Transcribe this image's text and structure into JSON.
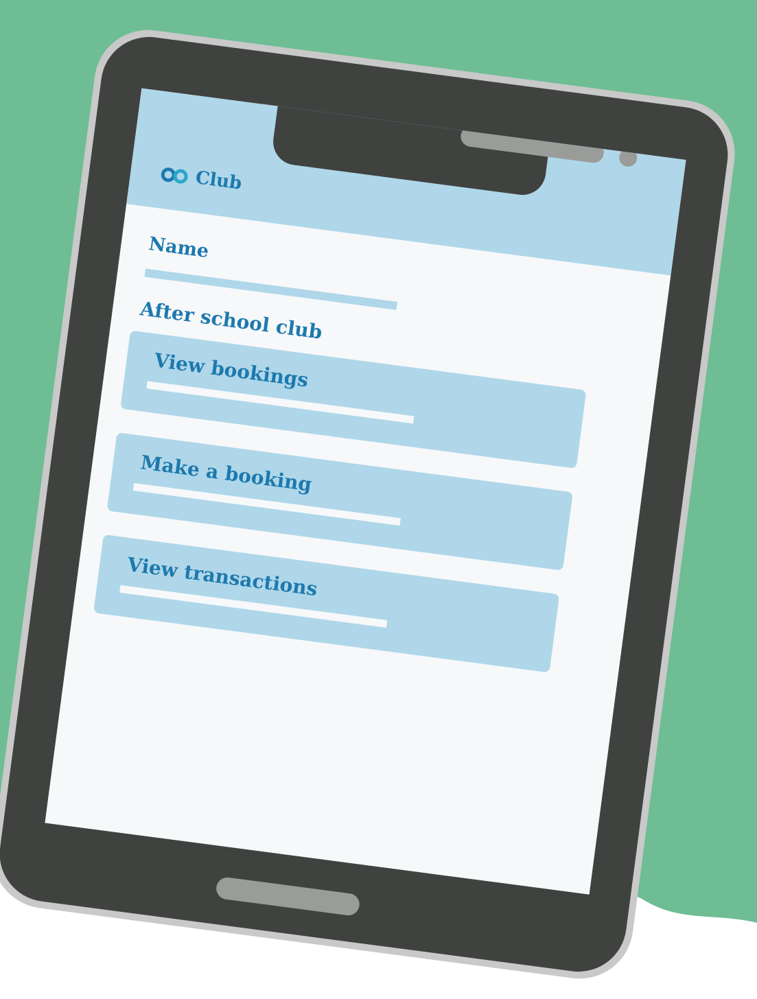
{
  "colors": {
    "background_green": "#6ebd94",
    "header_blue": "#afd7e9",
    "text_blue": "#1d79ae",
    "bezel_dark": "#404240",
    "bezel_frame": "#c8c9c8",
    "screen_white": "#f6f8fa"
  },
  "app": {
    "logo_icon": "infinity-logo-icon",
    "title": "Club"
  },
  "form": {
    "name_label": "Name"
  },
  "section": {
    "title": "After school club"
  },
  "menu": [
    {
      "label": "View bookings"
    },
    {
      "label": "Make a booking"
    },
    {
      "label": "View transactions"
    }
  ]
}
